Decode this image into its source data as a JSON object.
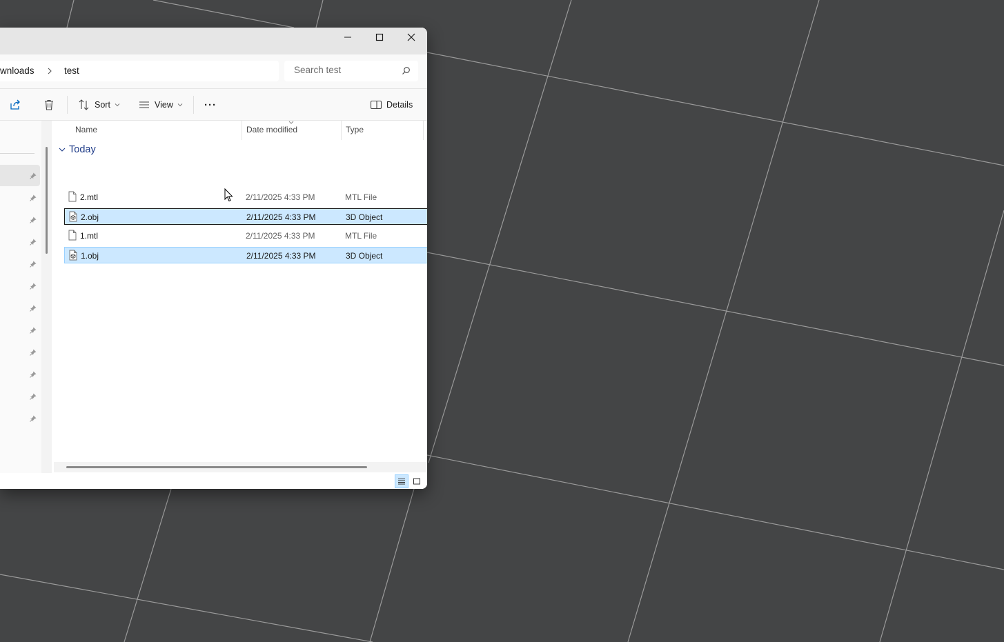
{
  "window": {
    "minimize_icon": "minimize-icon",
    "maximize_icon": "maximize-icon",
    "close_icon": "close-icon"
  },
  "address": {
    "previous_segment": "wnloads",
    "current_segment": "test",
    "separator_icon": "chevron-right-icon"
  },
  "search": {
    "placeholder": "Search test",
    "value": "",
    "icon": "search-icon"
  },
  "toolbar": {
    "share_icon": "share-icon",
    "delete_icon": "trash-icon",
    "sort_label": "Sort",
    "view_label": "View",
    "more_label": "···",
    "details_label": "Details"
  },
  "columns": {
    "name": "Name",
    "date_modified": "Date modified",
    "type": "Type"
  },
  "group": {
    "label": "Today"
  },
  "files": [
    {
      "name": "2.mtl",
      "date": "2/11/2025 4:33 PM",
      "type": "MTL File",
      "icon": "file-icon",
      "selected": false
    },
    {
      "name": "2.obj",
      "date": "2/11/2025 4:33 PM",
      "type": "3D Object",
      "icon": "3d-object-icon",
      "selected": true
    },
    {
      "name": "1.mtl",
      "date": "2/11/2025 4:33 PM",
      "type": "MTL File",
      "icon": "file-icon",
      "selected": false
    },
    {
      "name": "1.obj",
      "date": "2/11/2025 4:33 PM",
      "type": "3D Object",
      "icon": "3d-object-icon",
      "selected": true
    }
  ],
  "sidebar": {
    "pin_icon": "pin-icon",
    "pinned_items": 12
  },
  "statusbar": {
    "details_view_icon": "details-view-icon",
    "tiles_view_icon": "tiles-view-icon",
    "active_view": "details"
  },
  "colors": {
    "viewport_background": "#444546",
    "grid_line": "#9a9a9a",
    "selection_fill": "#cce8ff",
    "selection_border": "#99d1ff",
    "group_header": "#1f3c88"
  }
}
